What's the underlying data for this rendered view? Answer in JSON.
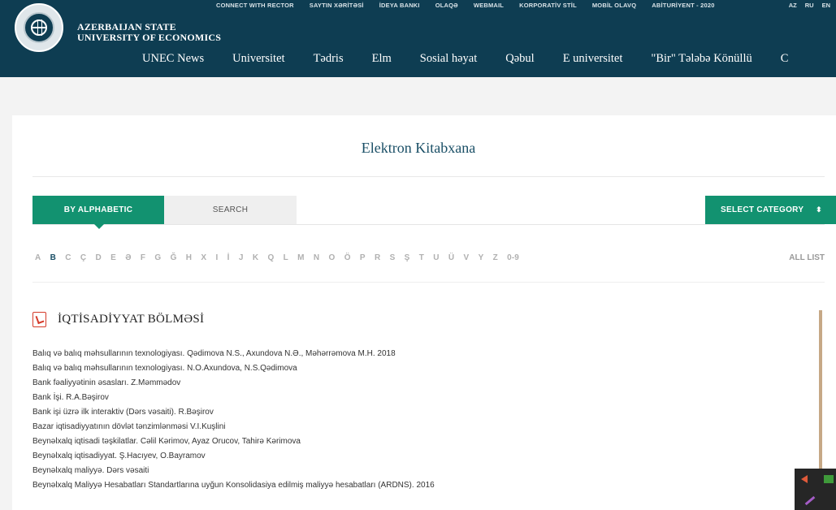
{
  "header": {
    "brand_line1": "AZERBAIJAN STATE",
    "brand_line2": "UNIVERSITY OF ECONOMICS",
    "top_links": [
      "CONNECT WITH RECTOR",
      "SAYTIN XƏRİTƏSİ",
      "İDEYA BANKI",
      "OLAQƏ",
      "WEBMAIL",
      "KORPORATİV STİL",
      "MOBİL OLAVQ",
      "ABİTURİYENT - 2020"
    ],
    "languages": [
      "AZ",
      "RU",
      "EN"
    ],
    "nav": [
      "UNEC News",
      "Universitet",
      "Tədris",
      "Elm",
      "Sosial həyat",
      "Qəbul",
      "E universitet",
      "\"Bir\" Tələbə Könüllü",
      "C"
    ]
  },
  "page": {
    "title": "Elektron Kitabxana",
    "tabs": {
      "alphabetic": "BY ALPHABETIC",
      "search": "SEARCH",
      "category": "SELECT CATEGORY",
      "category_arrow": "⬍"
    },
    "alphabet": [
      "A",
      "B",
      "C",
      "Ç",
      "D",
      "E",
      "Ə",
      "F",
      "G",
      "Ğ",
      "H",
      "X",
      "I",
      "İ",
      "J",
      "K",
      "Q",
      "L",
      "M",
      "N",
      "O",
      "Ö",
      "P",
      "R",
      "S",
      "Ş",
      "T",
      "U",
      "Ü",
      "V",
      "Y",
      "Z",
      "0-9"
    ],
    "active_letter": "B",
    "all_list": "ALL LIST",
    "section_title": "İQTİSADİYYAT BÖLMƏSİ",
    "books": [
      "Balıq və balıq məhsullarının texnologiyası. Qədimova N.S., Axundova N.Ə., Məhərrəmova M.H. 2018",
      "Balıq və balıq məhsullarının texnologiyası. N.O.Axundova, N.S.Qədimova",
      "Bank fəaliyyətinin əsasları. Z.Məmmədov",
      "Bank İşi. R.A.Bəşirov",
      "Bank işi üzrə ilk interaktiv (Dərs vəsaiti). R.Bəşirov",
      "Bazar iqtisadiyyatının dövlət tənzimlənməsi V.I.Kuşlini",
      "Beynəlxalq iqtisadi təşkilatlar. Cəlil Kərimov, Ayaz Orucov, Tahirə Kərimova",
      "Beynəlxalq iqtisadiyyat. Ş.Hacıyev, O.Bayramov",
      "Beynəlxalq maliyyə. Dərs vəsaiti",
      "Beynəlxalq Maliyyə Hesabatları Standartlarına uyğun Konsolidasiya edilmiş maliyyə hesabatları (ARDNS). 2016"
    ]
  },
  "colors": {
    "header_bg": "#0e3d52",
    "accent_green": "#129270",
    "title_blue": "#1a4f66",
    "pdf_red": "#d53b2a"
  },
  "icons": [
    "university-seal-icon",
    "pdf-icon",
    "select-arrows-icon",
    "speaker-icon",
    "pen-icon"
  ]
}
